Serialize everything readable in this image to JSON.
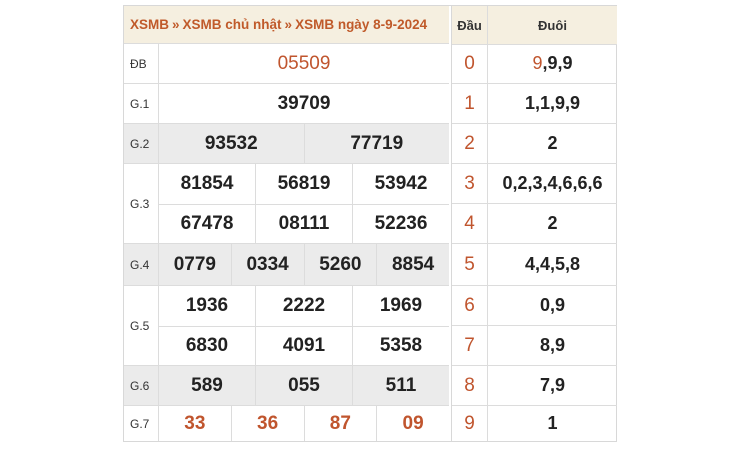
{
  "breadcrumb": {
    "items": [
      "XSMB",
      "XSMB chủ nhật",
      "XSMB ngày 8-9-2024"
    ],
    "separator": "»"
  },
  "prizes": {
    "db": {
      "label": "ĐB",
      "numbers": [
        "05509"
      ]
    },
    "g1": {
      "label": "G.1",
      "numbers": [
        "39709"
      ]
    },
    "g2": {
      "label": "G.2",
      "numbers": [
        "93532",
        "77719"
      ]
    },
    "g3": {
      "label": "G.3",
      "numbers": [
        "81854",
        "56819",
        "53942",
        "67478",
        "08111",
        "52236"
      ]
    },
    "g4": {
      "label": "G.4",
      "numbers": [
        "0779",
        "0334",
        "5260",
        "8854"
      ]
    },
    "g5": {
      "label": "G.5",
      "numbers": [
        "1936",
        "2222",
        "1969",
        "6830",
        "4091",
        "5358"
      ]
    },
    "g6": {
      "label": "G.6",
      "numbers": [
        "589",
        "055",
        "511"
      ]
    },
    "g7": {
      "label": "G.7",
      "numbers": [
        "33",
        "36",
        "87",
        "09"
      ]
    }
  },
  "loto": {
    "header_dau": "Đầu",
    "header_duoi": "Đuôi",
    "rows": [
      {
        "dau": "0",
        "duoi_hl": "9",
        "duoi_rest": ",9,9"
      },
      {
        "dau": "1",
        "duoi_hl": "",
        "duoi_rest": "1,1,9,9"
      },
      {
        "dau": "2",
        "duoi_hl": "",
        "duoi_rest": "2"
      },
      {
        "dau": "3",
        "duoi_hl": "",
        "duoi_rest": "0,2,3,4,6,6,6"
      },
      {
        "dau": "4",
        "duoi_hl": "",
        "duoi_rest": "2"
      },
      {
        "dau": "5",
        "duoi_hl": "",
        "duoi_rest": "4,4,5,8"
      },
      {
        "dau": "6",
        "duoi_hl": "",
        "duoi_rest": "0,9"
      },
      {
        "dau": "7",
        "duoi_hl": "",
        "duoi_rest": "8,9"
      },
      {
        "dau": "8",
        "duoi_hl": "",
        "duoi_rest": "7,9"
      },
      {
        "dau": "9",
        "duoi_hl": "",
        "duoi_rest": "1"
      }
    ]
  },
  "colors": {
    "accent": "#c0552e",
    "header_bg": "#f5efe0",
    "row_gray": "#ebebeb"
  }
}
